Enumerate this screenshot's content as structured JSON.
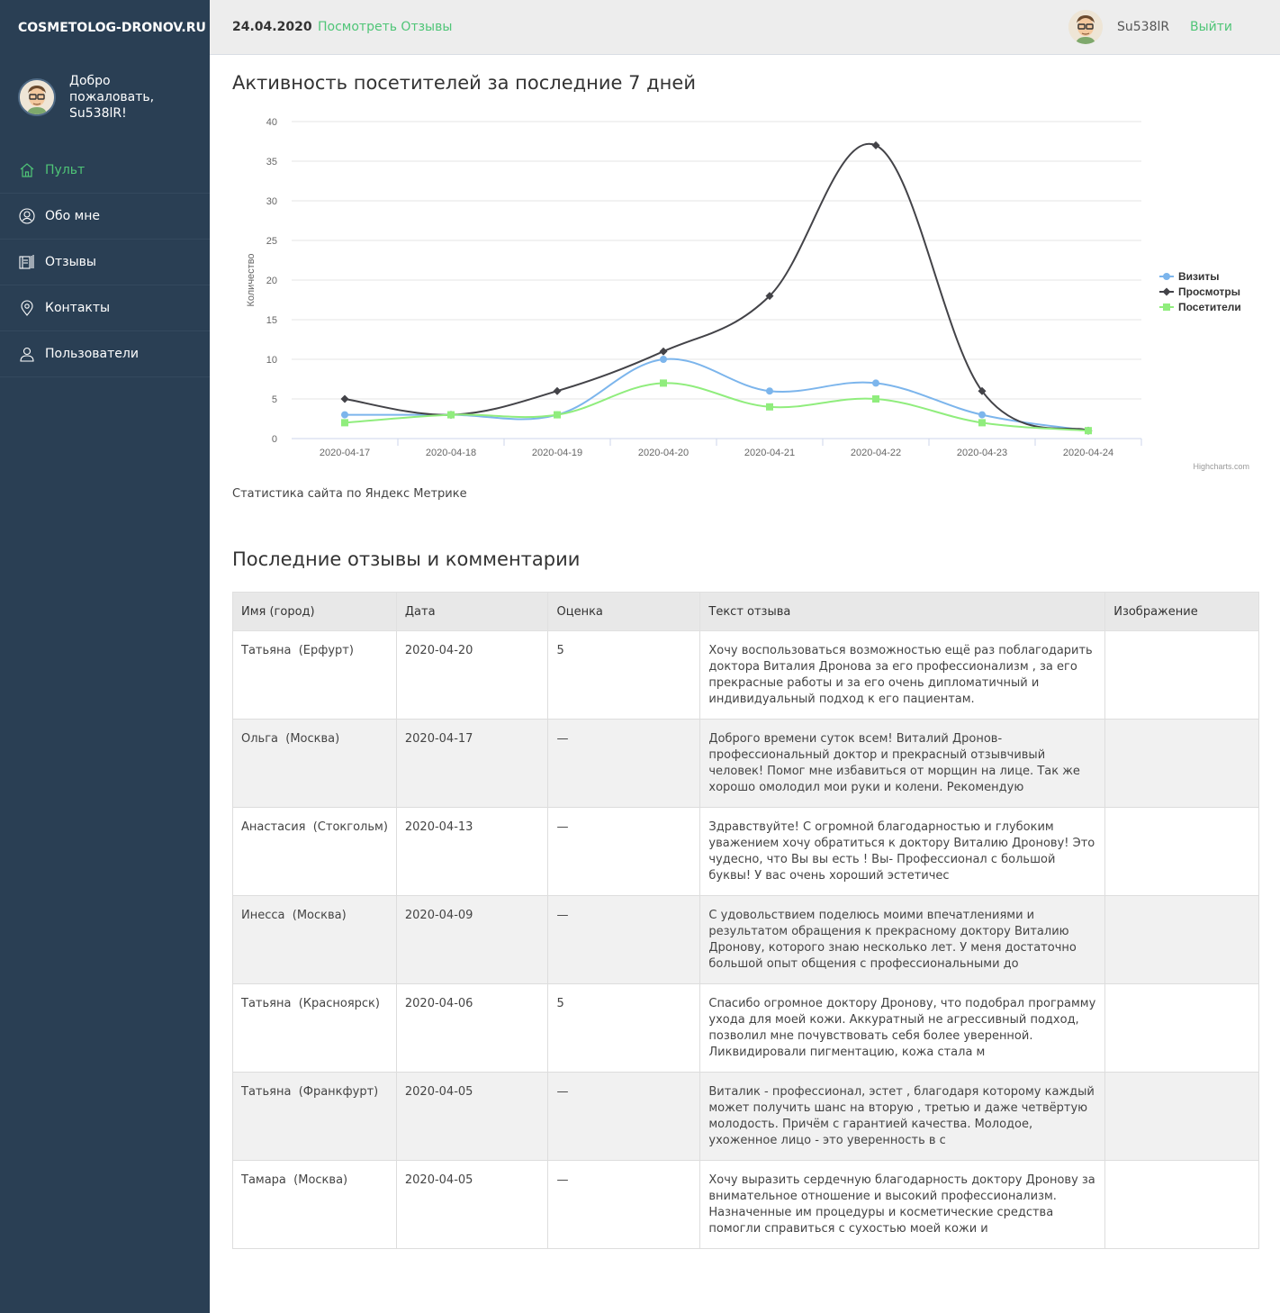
{
  "brand": "COSMETOLOG-DRONOV.RU",
  "welcome": {
    "line1": "Добро пожаловать,",
    "line2": "Su538lR!"
  },
  "menu": [
    {
      "label": "Пульт",
      "icon": "home-icon",
      "active": true
    },
    {
      "label": "Обо мне",
      "icon": "user-circle-icon",
      "active": false
    },
    {
      "label": "Отзывы",
      "icon": "book-icon",
      "active": false
    },
    {
      "label": "Контакты",
      "icon": "map-pin-icon",
      "active": false
    },
    {
      "label": "Пользователи",
      "icon": "users-icon",
      "active": false
    }
  ],
  "topbar": {
    "date": "24.04.2020",
    "reviews_link": "Посмотреть Отзывы",
    "username": "Su538lR",
    "logout": "Выйти"
  },
  "colors": {
    "sidebar": "#2a3f54",
    "accent": "#4fc577",
    "visits": "#7cb5ec",
    "views": "#434348",
    "visitors": "#90ed7d"
  },
  "activity": {
    "title": "Активность посетителей за последние 7 дней",
    "caption": "Статистика сайта по Яндекс Метрике",
    "credits": "Highcharts.com"
  },
  "chart_data": {
    "type": "line",
    "ylabel": "Количество",
    "ylim": [
      0,
      40
    ],
    "yticks": [
      0,
      5,
      10,
      15,
      20,
      25,
      30,
      35,
      40
    ],
    "categories": [
      "2020-04-17",
      "2020-04-18",
      "2020-04-19",
      "2020-04-20",
      "2020-04-21",
      "2020-04-22",
      "2020-04-23",
      "2020-04-24"
    ],
    "legend_position": "right",
    "grid": true,
    "series": [
      {
        "name": "Визиты",
        "values": [
          3,
          3,
          3,
          10,
          6,
          7,
          3,
          1
        ],
        "marker": "circle"
      },
      {
        "name": "Просмотры",
        "values": [
          5,
          3,
          6,
          11,
          18,
          37,
          6,
          1
        ],
        "marker": "diamond"
      },
      {
        "name": "Посетители",
        "values": [
          2,
          3,
          3,
          7,
          4,
          5,
          2,
          1
        ],
        "marker": "square"
      }
    ]
  },
  "reviews": {
    "title": "Последние отзывы и комментарии",
    "headers": [
      "Имя (город)",
      "Дата",
      "Оценка",
      "Текст отзыва",
      "Изображение"
    ],
    "rows": [
      {
        "name": "Татьяна",
        "city": "(Ерфурт)",
        "date": "2020-04-20",
        "rating": "5",
        "text": "Хочу воспользоваться возможностью ещё раз поблагодарить доктора Виталия Дронова за его профессионализм , за его прекрасные работы и за его очень дипломатичный и индивидуальный подход к его пациентам."
      },
      {
        "name": "Ольга",
        "city": "(Москва)",
        "date": "2020-04-17",
        "rating": "—",
        "text": "Доброго времени суток всем! Виталий Дронов- профессиональный доктор и прекрасный отзывчивый человек! Помог мне избавиться от морщин на лице. Так же хорошо омолодил мои руки и колени. Рекомендую"
      },
      {
        "name": "Анастасия",
        "city": "(Стокгольм)",
        "date": "2020-04-13",
        "rating": "—",
        "text": "Здравствуйте! С огромной благодарностью и глубоким уважением хочу обратиться к доктору Виталию Дронову! Это чудесно, что Вы вы есть ! Вы- Профессионал с большой буквы! У вас очень хороший эстетичес"
      },
      {
        "name": "Инесса",
        "city": "(Москва)",
        "date": "2020-04-09",
        "rating": "—",
        "text": "С удовольствием поделюсь моими впечатлениями и результатом обращения к прекрасному доктору Виталию Дронову, которого знаю несколько лет. У меня достаточно большой опыт общения с профессиональными до"
      },
      {
        "name": "Татьяна",
        "city": "(Красноярск)",
        "date": "2020-04-06",
        "rating": "5",
        "text": "Спасибо огромное доктору Дронову, что подобрал программу ухода для моей кожи. Аккуратный не агрессивный подход, позволил мне почувствовать себя более уверенной. Ликвидировали пигментацию, кожа стала м"
      },
      {
        "name": "Татьяна",
        "city": "(Франкфурт)",
        "date": "2020-04-05",
        "rating": "—",
        "text": "Виталик - профессионал, эстет , благодаря которому каждый может получить шанс на вторую , третью и даже четвёртую молодость. Причём с гарантией качества. Молодое, ухоженное лицо - это уверенность в с"
      },
      {
        "name": "Тамара",
        "city": "(Москва)",
        "date": "2020-04-05",
        "rating": "—",
        "text": "Хочу выразить сердечную благодарность доктору Дронову за внимательное отношение и высокий профессионализм. Назначенные им процедуры и косметические средства помогли справиться с сухостью моей кожи и"
      }
    ]
  }
}
